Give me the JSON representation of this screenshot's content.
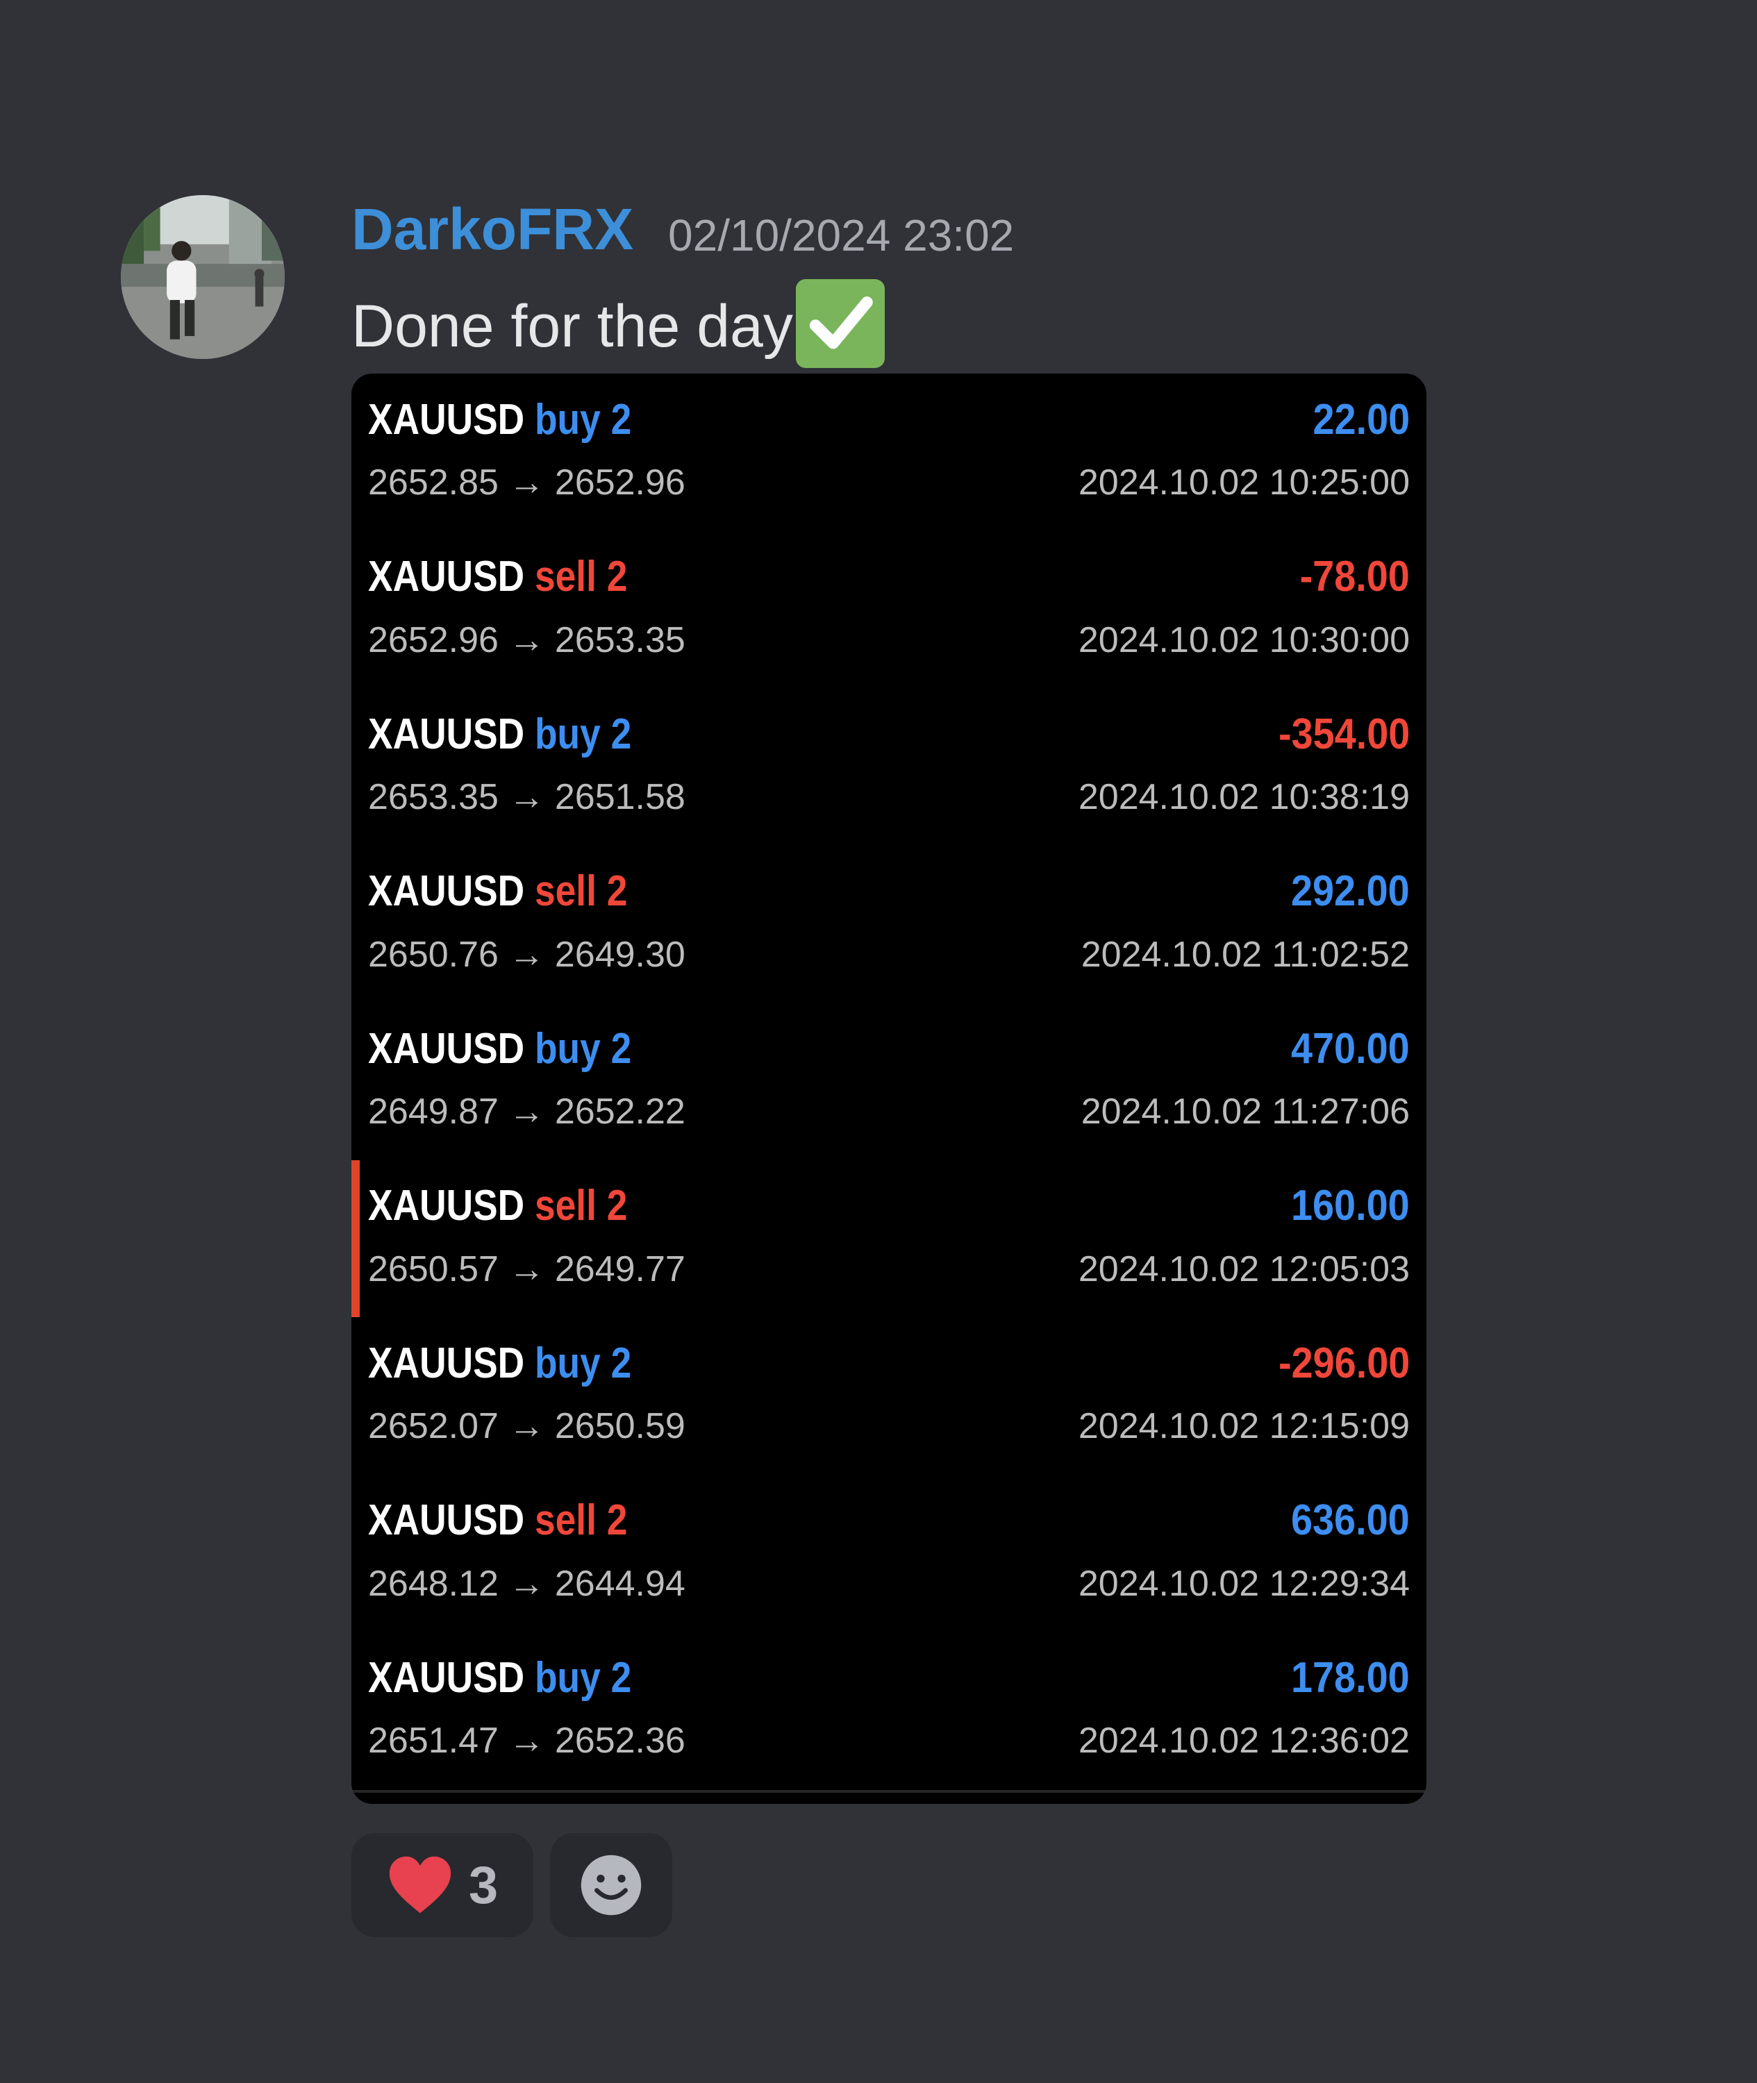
{
  "message": {
    "username": "DarkoFRX",
    "timestamp": "02/10/2024 23:02",
    "text": "Done for the day",
    "emoji": "check-mark-button-icon",
    "username_color": "#3d8fd9"
  },
  "trades": [
    {
      "symbol": "XAUUSD",
      "side": "buy 2",
      "direction": "buy",
      "prices": "2652.85 → 2652.96",
      "profit": "22.00",
      "time": "2024.10.02 10:25:00"
    },
    {
      "symbol": "XAUUSD",
      "side": "sell 2",
      "direction": "sell",
      "prices": "2652.96 → 2653.35",
      "profit": "-78.00",
      "time": "2024.10.02 10:30:00"
    },
    {
      "symbol": "XAUUSD",
      "side": "buy 2",
      "direction": "buy",
      "prices": "2653.35 → 2651.58",
      "profit": "-354.00",
      "time": "2024.10.02 10:38:19"
    },
    {
      "symbol": "XAUUSD",
      "side": "sell 2",
      "direction": "sell",
      "prices": "2650.76 → 2649.30",
      "profit": "292.00",
      "time": "2024.10.02 11:02:52"
    },
    {
      "symbol": "XAUUSD",
      "side": "buy 2",
      "direction": "buy",
      "prices": "2649.87 → 2652.22",
      "profit": "470.00",
      "time": "2024.10.02 11:27:06"
    },
    {
      "symbol": "XAUUSD",
      "side": "sell 2",
      "direction": "sell",
      "prices": "2650.57 → 2649.77",
      "profit": "160.00",
      "time": "2024.10.02 12:05:03",
      "highlighted": true
    },
    {
      "symbol": "XAUUSD",
      "side": "buy 2",
      "direction": "buy",
      "prices": "2652.07 → 2650.59",
      "profit": "-296.00",
      "time": "2024.10.02 12:15:09"
    },
    {
      "symbol": "XAUUSD",
      "side": "sell 2",
      "direction": "sell",
      "prices": "2648.12 → 2644.94",
      "profit": "636.00",
      "time": "2024.10.02 12:29:34"
    },
    {
      "symbol": "XAUUSD",
      "side": "buy 2",
      "direction": "buy",
      "prices": "2651.47 → 2652.36",
      "profit": "178.00",
      "time": "2024.10.02 12:36:02"
    }
  ],
  "reactions": [
    {
      "icon": "heart-icon",
      "count": "3"
    },
    {
      "icon": "add-reaction-smile-icon"
    }
  ],
  "colors": {
    "background": "#303237",
    "buy": "#3d8ef0",
    "sell": "#f0473a",
    "heart": "#e8414f",
    "check_emoji": "#7ab55c"
  }
}
